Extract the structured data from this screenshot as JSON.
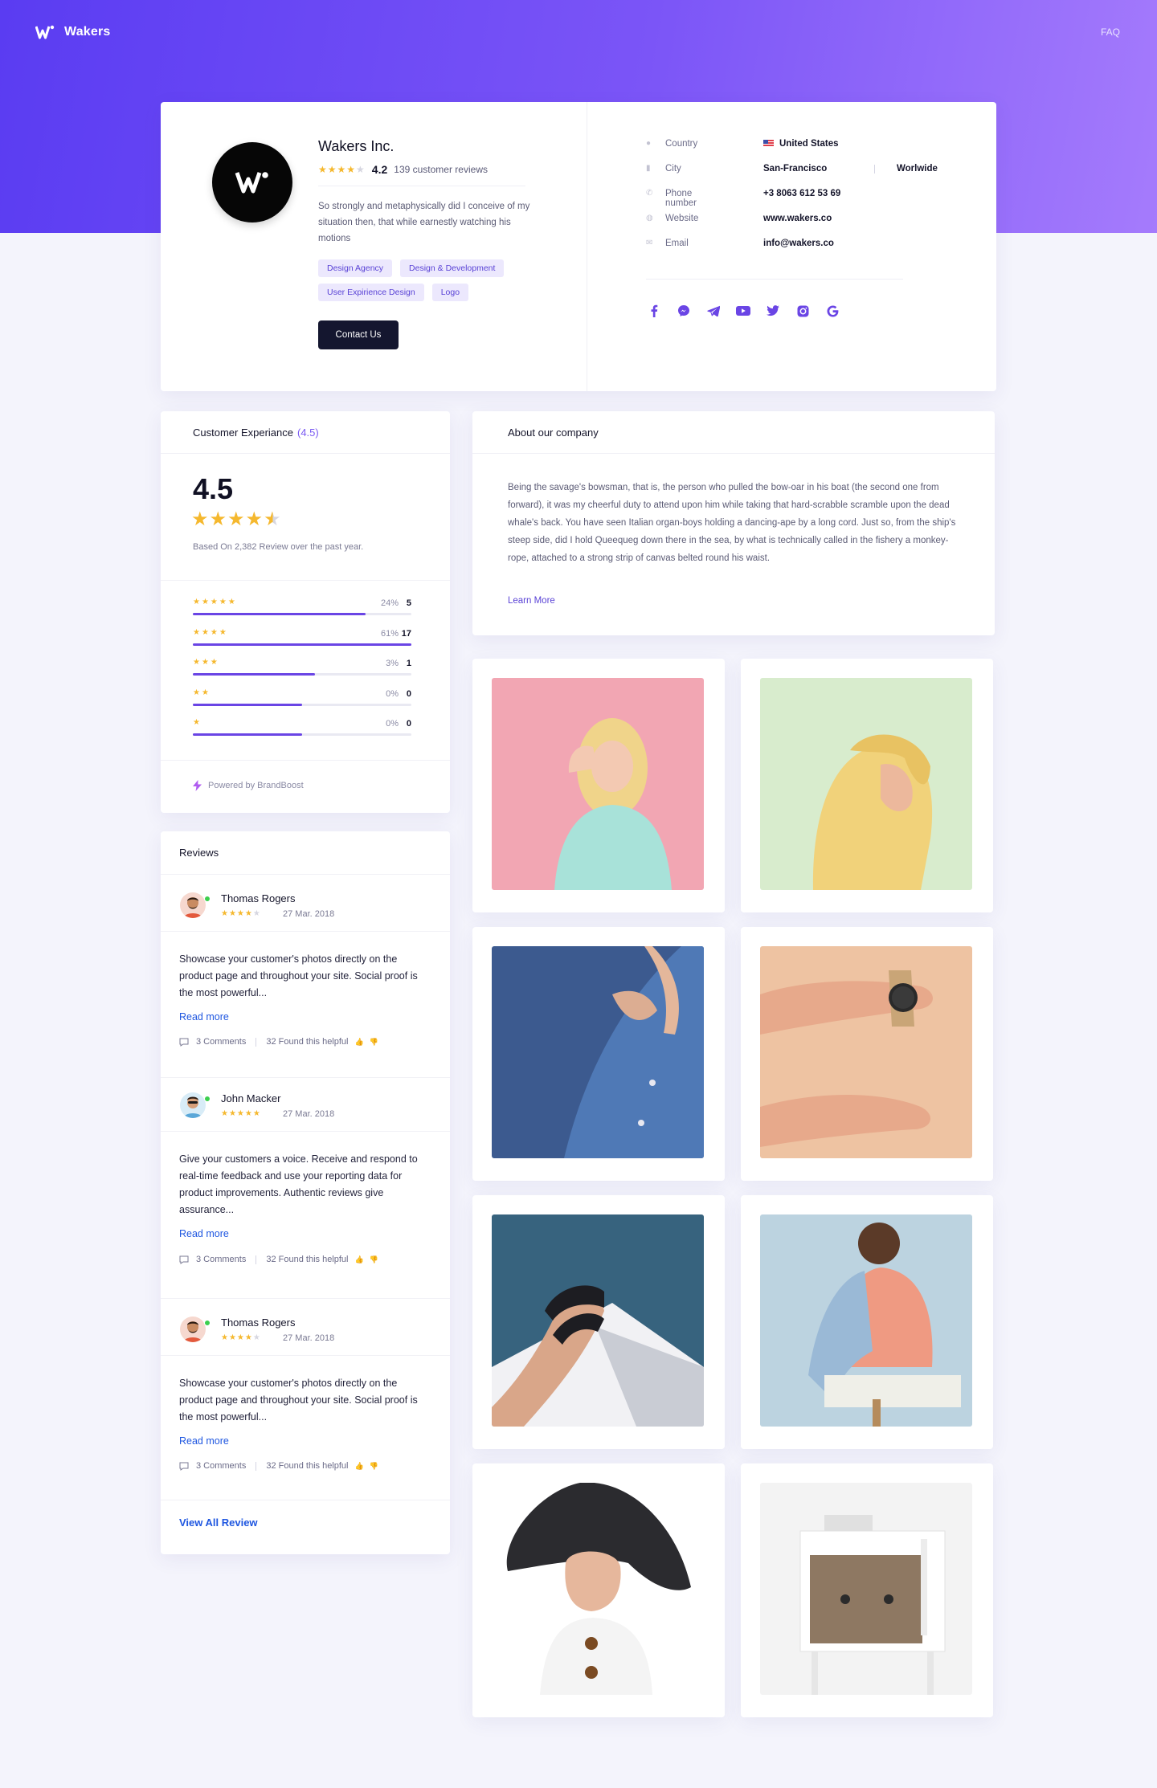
{
  "header": {
    "brand": "Wakers",
    "faq": "FAQ"
  },
  "profile": {
    "name": "Wakers Inc.",
    "rating": "4.2",
    "reviews_text": "139 customer reviews",
    "description": "So strongly and metaphysically did I conceive of my situation then, that while earnestly watching his motions",
    "tags": [
      "Design Agency",
      "Design & Development",
      "User Expirience Design",
      "Logo"
    ],
    "contact_button": "Contact Us"
  },
  "info": {
    "country_label": "Country",
    "country_value": "United States",
    "city_label": "City",
    "city_value": "San-Francisco",
    "city_value2": "Worlwide",
    "phone_label": "Phone number",
    "phone_value": "+3 8063 612 53 69",
    "website_label": "Website",
    "website_value": "www.wakers.co",
    "email_label": "Email",
    "email_value": "info@wakers.co",
    "socials": [
      "facebook-icon",
      "messenger-icon",
      "telegram-icon",
      "youtube-icon",
      "twitter-icon",
      "instagram-icon",
      "google-icon"
    ]
  },
  "experience": {
    "title": "Customer Experiance",
    "title_score": "(4.5)",
    "score": "4.5",
    "based_on": "Based On 2,382 Review over the past year.",
    "distribution": [
      {
        "stars": "★★★★★",
        "percent": "24%",
        "count": "5",
        "fill": 0.79
      },
      {
        "stars": "★★★★",
        "percent": "61%",
        "count": "17",
        "fill": 1.0
      },
      {
        "stars": "★★★",
        "percent": "3%",
        "count": "1",
        "fill": 0.56
      },
      {
        "stars": "★★",
        "percent": "0%",
        "count": "0",
        "fill": 0.5
      },
      {
        "stars": "★",
        "percent": "0%",
        "count": "0",
        "fill": 0.5
      }
    ],
    "powered_by": "Powered by BrandBoost"
  },
  "about": {
    "title": "About our company",
    "text": "Being the savage's bowsman, that is, the person who pulled the bow-oar in his boat (the second one from forward), it was my cheerful duty to attend upon him while taking that hard-scrabble scramble upon the dead whale's back. You have seen Italian organ-boys holding a dancing-ape by a long cord. Just so, from the ship's steep side, did I hold Queequeg down there in the sea, by what is technically called in the fishery a monkey-rope, attached to a strong strip of canvas belted round his waist.",
    "learn_more": "Learn More"
  },
  "reviews": {
    "title": "Reviews",
    "items": [
      {
        "name": "Thomas Rogers",
        "date": "27 Mar. 2018",
        "rating": 4,
        "text": "Showcase your customer's photos directly on the product page and throughout your site. Social proof is the most powerful...",
        "read_more": "Read more",
        "comments": "3 Comments",
        "helpful": "32 Found this helpful"
      },
      {
        "name": "John Macker",
        "date": "27 Mar. 2018",
        "rating": 5,
        "text": "Give your customers a voice. Receive and respond to real-time feedback and use your reporting data for product improvements. Authentic reviews give assurance...",
        "read_more": "Read more",
        "comments": "3 Comments",
        "helpful": "32 Found this helpful"
      },
      {
        "name": "Thomas Rogers",
        "date": "27 Mar. 2018",
        "rating": 4,
        "text": "Showcase your customer's photos directly on the product page and throughout your site. Social proof is the most powerful...",
        "read_more": "Read more",
        "comments": "3 Comments",
        "helpful": "32 Found this helpful"
      }
    ],
    "view_all": "View All Review"
  },
  "colors": {
    "accent": "#6a45e5",
    "star": "#f5b82e",
    "link": "#1e56e0",
    "dark_button": "#14162f"
  }
}
